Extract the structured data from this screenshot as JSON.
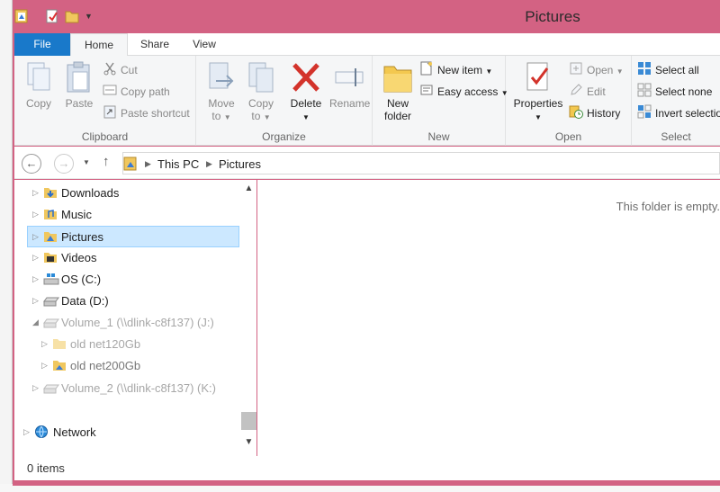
{
  "window": {
    "title": "Pictures"
  },
  "ribbon": {
    "tabs": [
      {
        "label": "File"
      },
      {
        "label": "Home"
      },
      {
        "label": "Share"
      },
      {
        "label": "View"
      }
    ],
    "clipboard": {
      "label": "Clipboard",
      "copy": "Copy",
      "paste": "Paste",
      "cut": "Cut",
      "copy_path": "Copy path",
      "paste_shortcut": "Paste shortcut"
    },
    "organize": {
      "label": "Organize",
      "move_to": "Move to",
      "copy_to": "Copy to",
      "delete": "Delete",
      "rename": "Rename"
    },
    "new": {
      "label": "New",
      "new_folder": "New folder",
      "new_item": "New item",
      "easy_access": "Easy access"
    },
    "open": {
      "label": "Open",
      "properties": "Properties",
      "open": "Open",
      "edit": "Edit",
      "history": "History"
    },
    "select": {
      "label": "Select",
      "select_all": "Select all",
      "select_none": "Select none",
      "invert_selection": "Invert selection"
    }
  },
  "address": {
    "crumbs": [
      "This PC",
      "Pictures"
    ]
  },
  "nav": {
    "items": [
      {
        "label": "Downloads"
      },
      {
        "label": "Music"
      },
      {
        "label": "Pictures"
      },
      {
        "label": "Videos"
      },
      {
        "label": "OS (C:)"
      },
      {
        "label": "Data (D:)"
      },
      {
        "label": "Volume_1 (\\\\dlink-c8f137) (J:)"
      },
      {
        "label": "old net120Gb"
      },
      {
        "label": "old net200Gb"
      },
      {
        "label": "Volume_2 (\\\\dlink-c8f137) (K:)"
      },
      {
        "label": "Network"
      }
    ]
  },
  "content": {
    "empty_message": "This folder is empty."
  },
  "status": {
    "items_count": "0 items"
  },
  "colors": {
    "titlebar": "#d36283",
    "file_tab": "#1979ca",
    "selection": "#cce8ff",
    "selection_border": "#99d1ff"
  }
}
